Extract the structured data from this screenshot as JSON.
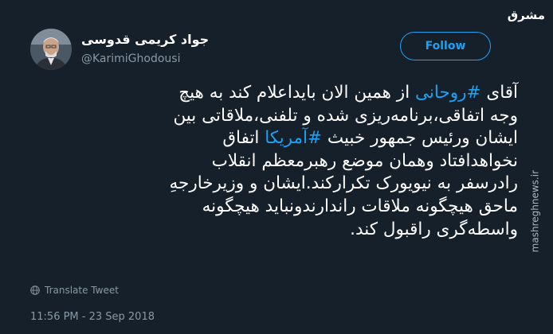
{
  "author": {
    "display_name": "جواد کریمی قدوسی",
    "handle": "@KarimiGhodousi"
  },
  "follow_button": {
    "label": "Follow"
  },
  "brand": {
    "logo_text": "مشرق",
    "url": "mashreghnews.ir"
  },
  "tweet": {
    "lines": [
      [
        {
          "t": "آقای ",
          "h": false
        },
        {
          "t": "#روحانی",
          "h": true
        },
        {
          "t": " از همین الان بایداعلام کند به هیچ",
          "h": false
        }
      ],
      [
        {
          "t": "وجه اتفاقی،برنامه‌ریزی شده و تلفنی،ملاقاتی بین",
          "h": false
        }
      ],
      [
        {
          "t": "ایشان ورئیس جمهور خبیث ",
          "h": false
        },
        {
          "t": "#آمریکا",
          "h": true
        },
        {
          "t": " اتفاق",
          "h": false
        }
      ],
      [
        {
          "t": "نخواهدافتاد وهمان موضع رهبرمعظم انقلاب",
          "h": false
        }
      ],
      [
        {
          "t": "رادرسفر به نیویورک تکرارکند.ایشان و وزیرخارجهِ",
          "h": false
        }
      ],
      [
        {
          "t": "ماحق هیچگونه ملاقات راندارندونباید هیچگونه",
          "h": false
        }
      ],
      [
        {
          "t": "واسطه‌گری راقبول کند.",
          "h": false
        }
      ]
    ]
  },
  "translate": {
    "label": "Translate Tweet"
  },
  "timestamp": "11:56 PM - 23 Sep 2018",
  "colors": {
    "background": "#15202b",
    "accent": "#1da1f2",
    "muted": "#8899a6",
    "text": "#ffffff"
  }
}
